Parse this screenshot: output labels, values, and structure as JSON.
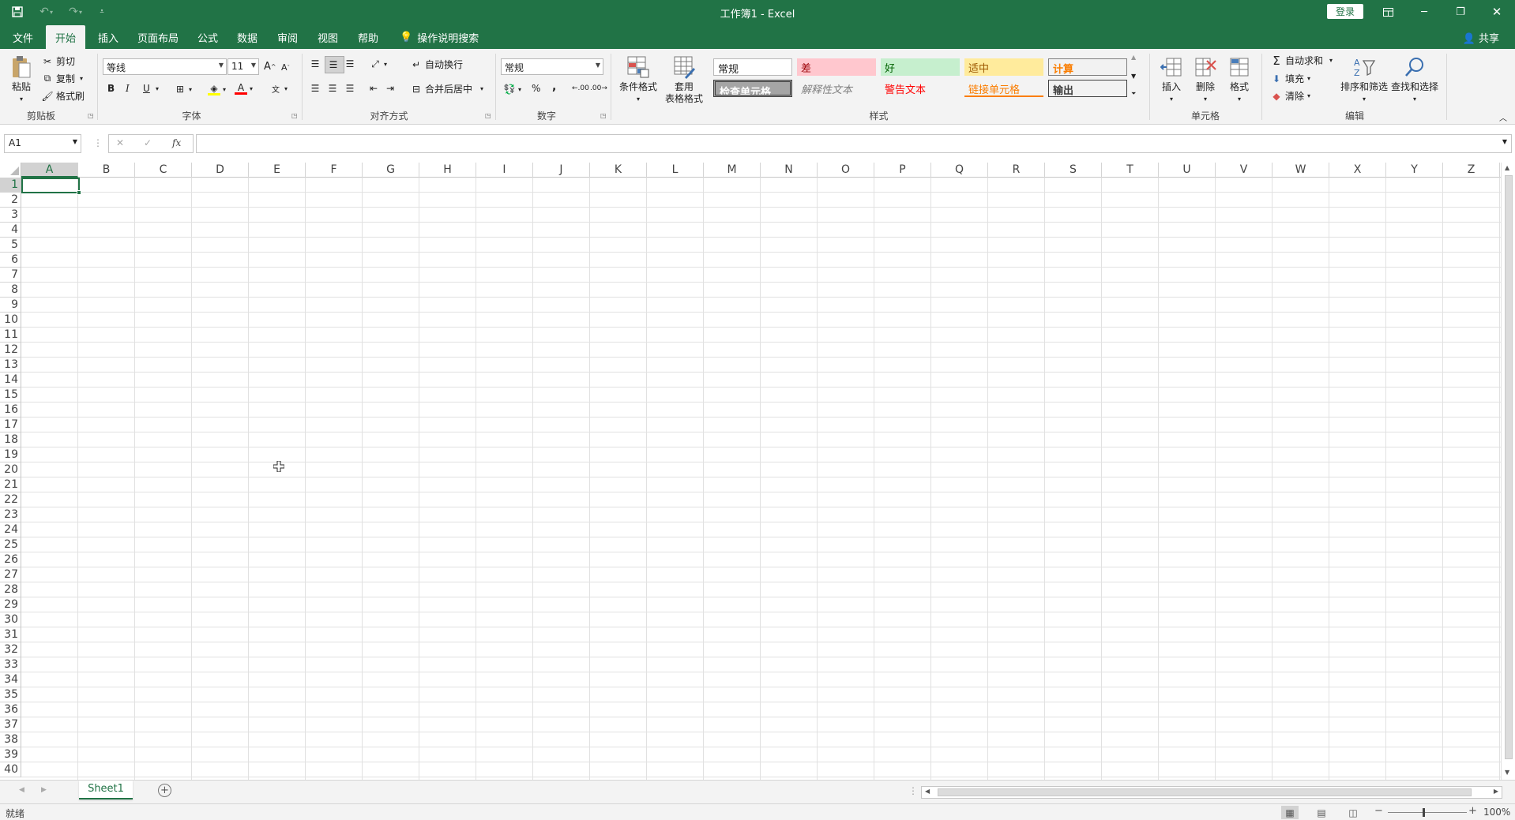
{
  "app": {
    "title": "工作簿1  -  Excel",
    "login": "登录",
    "share": "共享"
  },
  "quick_access": [
    "save-icon",
    "undo-icon",
    "redo-icon",
    "customize-icon"
  ],
  "tabs": [
    "文件",
    "开始",
    "插入",
    "页面布局",
    "公式",
    "数据",
    "审阅",
    "视图",
    "帮助",
    "操作说明搜索"
  ],
  "active_tab": "开始",
  "ribbon": {
    "clipboard": {
      "label": "剪贴板",
      "paste": "粘贴",
      "cut": "剪切",
      "copy": "复制",
      "format_painter": "格式刷"
    },
    "font": {
      "label": "字体",
      "font_name": "等线",
      "font_size": "11",
      "bold": "B",
      "italic": "I",
      "underline": "U",
      "grow": "A",
      "shrink": "A",
      "font_color": "A"
    },
    "alignment": {
      "label": "对齐方式",
      "wrap_text": "自动换行",
      "merge_center": "合并后居中"
    },
    "number": {
      "label": "数字",
      "format": "常规",
      "percent": "%",
      "comma": ",",
      "inc_decimal": ".00",
      "dec_decimal": ".00"
    },
    "styles": {
      "label": "样式",
      "conditional": "条件格式",
      "table_format_1": "套用",
      "table_format_2": "表格格式",
      "cells": [
        {
          "name": "常规",
          "bg": "#ffffff",
          "fg": "#222222",
          "border": "#b9b9b9"
        },
        {
          "name": "差",
          "bg": "#ffc7ce",
          "fg": "#9c0006"
        },
        {
          "name": "好",
          "bg": "#c6efce",
          "fg": "#006100"
        },
        {
          "name": "适中",
          "bg": "#ffeb9c",
          "fg": "#9c5700"
        },
        {
          "name": "计算",
          "bg": "#f2f2f2",
          "fg": "#fa7d00",
          "border": "#7f7f7f"
        },
        {
          "name": "检查单元格",
          "bg": "#a5a5a5",
          "fg": "#ffffff",
          "border": "#3f3f3f"
        },
        {
          "name": "解释性文本",
          "bg": "#f3f3f3",
          "fg": "#7f7f7f"
        },
        {
          "name": "警告文本",
          "bg": "#f3f3f3",
          "fg": "#ff0000"
        },
        {
          "name": "链接单元格",
          "bg": "#f3f3f3",
          "fg": "#fa7d00"
        },
        {
          "name": "输出",
          "bg": "#f2f2f2",
          "fg": "#3f3f3f",
          "border": "#3f3f3f"
        }
      ]
    },
    "cells": {
      "label": "单元格",
      "insert": "插入",
      "delete": "删除",
      "format": "格式"
    },
    "editing": {
      "label": "编辑",
      "autosum": "自动求和",
      "fill": "填充",
      "clear": "清除",
      "sort_filter": "排序和筛选",
      "find_select": "查找和选择"
    }
  },
  "formula_bar": {
    "name_box": "A1",
    "formula": "",
    "fx": "fx"
  },
  "columns": [
    "A",
    "B",
    "C",
    "D",
    "E",
    "F",
    "G",
    "H",
    "I",
    "J",
    "K",
    "L",
    "M",
    "N",
    "O",
    "P",
    "Q",
    "R",
    "S",
    "T",
    "U",
    "V",
    "W",
    "X",
    "Y",
    "Z"
  ],
  "rows": [
    "1",
    "2",
    "3",
    "4",
    "5",
    "6",
    "7",
    "8",
    "9",
    "10",
    "11",
    "12",
    "13",
    "14",
    "15",
    "16",
    "17",
    "18",
    "19",
    "20",
    "21",
    "22",
    "23",
    "24",
    "25",
    "26",
    "27",
    "28",
    "29",
    "30",
    "31",
    "32",
    "33",
    "34",
    "35",
    "36",
    "37",
    "38",
    "39",
    "40"
  ],
  "active_cell": "A1",
  "sheet_tabs": [
    "Sheet1"
  ],
  "status": {
    "text": "就绪",
    "zoom": "100%"
  },
  "colors": {
    "accent": "#217346"
  }
}
